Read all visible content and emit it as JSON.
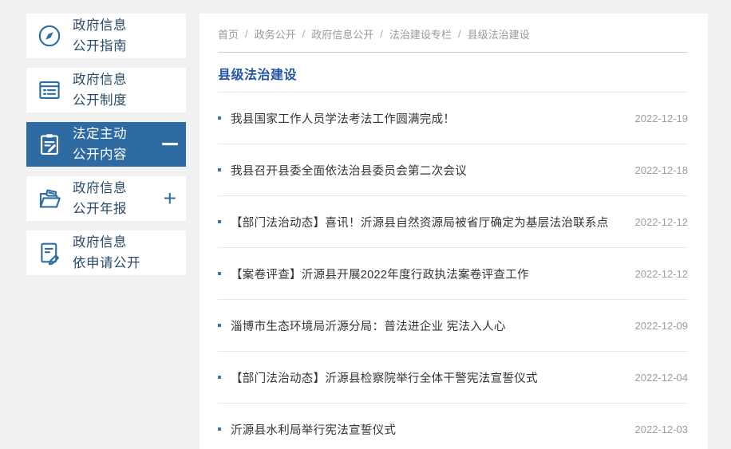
{
  "page": {
    "background": "#f1f1f1",
    "accent_blue": "#2e6da4",
    "active_item_bg": "#2f6ba3",
    "title_color": "#2155a4"
  },
  "sidebar": {
    "items": [
      {
        "line1": "政府信息",
        "line2": "公开指南",
        "icon": "compass-icon",
        "active": false,
        "expander": ""
      },
      {
        "line1": "政府信息",
        "line2": "公开制度",
        "icon": "document-list-icon",
        "active": false,
        "expander": ""
      },
      {
        "line1": "法定主动",
        "line2": "公开内容",
        "icon": "clipboard-pen-icon",
        "active": true,
        "expander": "−"
      },
      {
        "line1": "政府信息",
        "line2": "公开年报",
        "icon": "folder-doc-icon",
        "active": false,
        "expander": "+"
      },
      {
        "line1": "政府信息",
        "line2": "依申请公开",
        "icon": "doc-pencil-icon",
        "active": false,
        "expander": ""
      }
    ]
  },
  "breadcrumb": {
    "separator": "/",
    "items": [
      "首页",
      "政务公开",
      "政府信息公开",
      "法治建设专栏",
      "县级法治建设"
    ]
  },
  "main": {
    "title": "县级法治建设",
    "articles": [
      {
        "title": "我县国家工作人员学法考法工作圆满完成！",
        "date": "2022-12-19"
      },
      {
        "title": "我县召开县委全面依法治县委员会第二次会议",
        "date": "2022-12-18"
      },
      {
        "title": "【部门法治动态】喜讯！沂源县自然资源局被省厅确定为基层法治联系点",
        "date": "2022-12-12"
      },
      {
        "title": "【案卷评查】沂源县开展2022年度行政执法案卷评查工作",
        "date": "2022-12-12"
      },
      {
        "title": "淄博市生态环境局沂源分局：普法进企业 宪法入人心",
        "date": "2022-12-09"
      },
      {
        "title": "【部门法治动态】沂源县检察院举行全体干警宪法宣誓仪式",
        "date": "2022-12-04"
      },
      {
        "title": "沂源县水利局举行宪法宣誓仪式",
        "date": "2022-12-03"
      }
    ]
  }
}
